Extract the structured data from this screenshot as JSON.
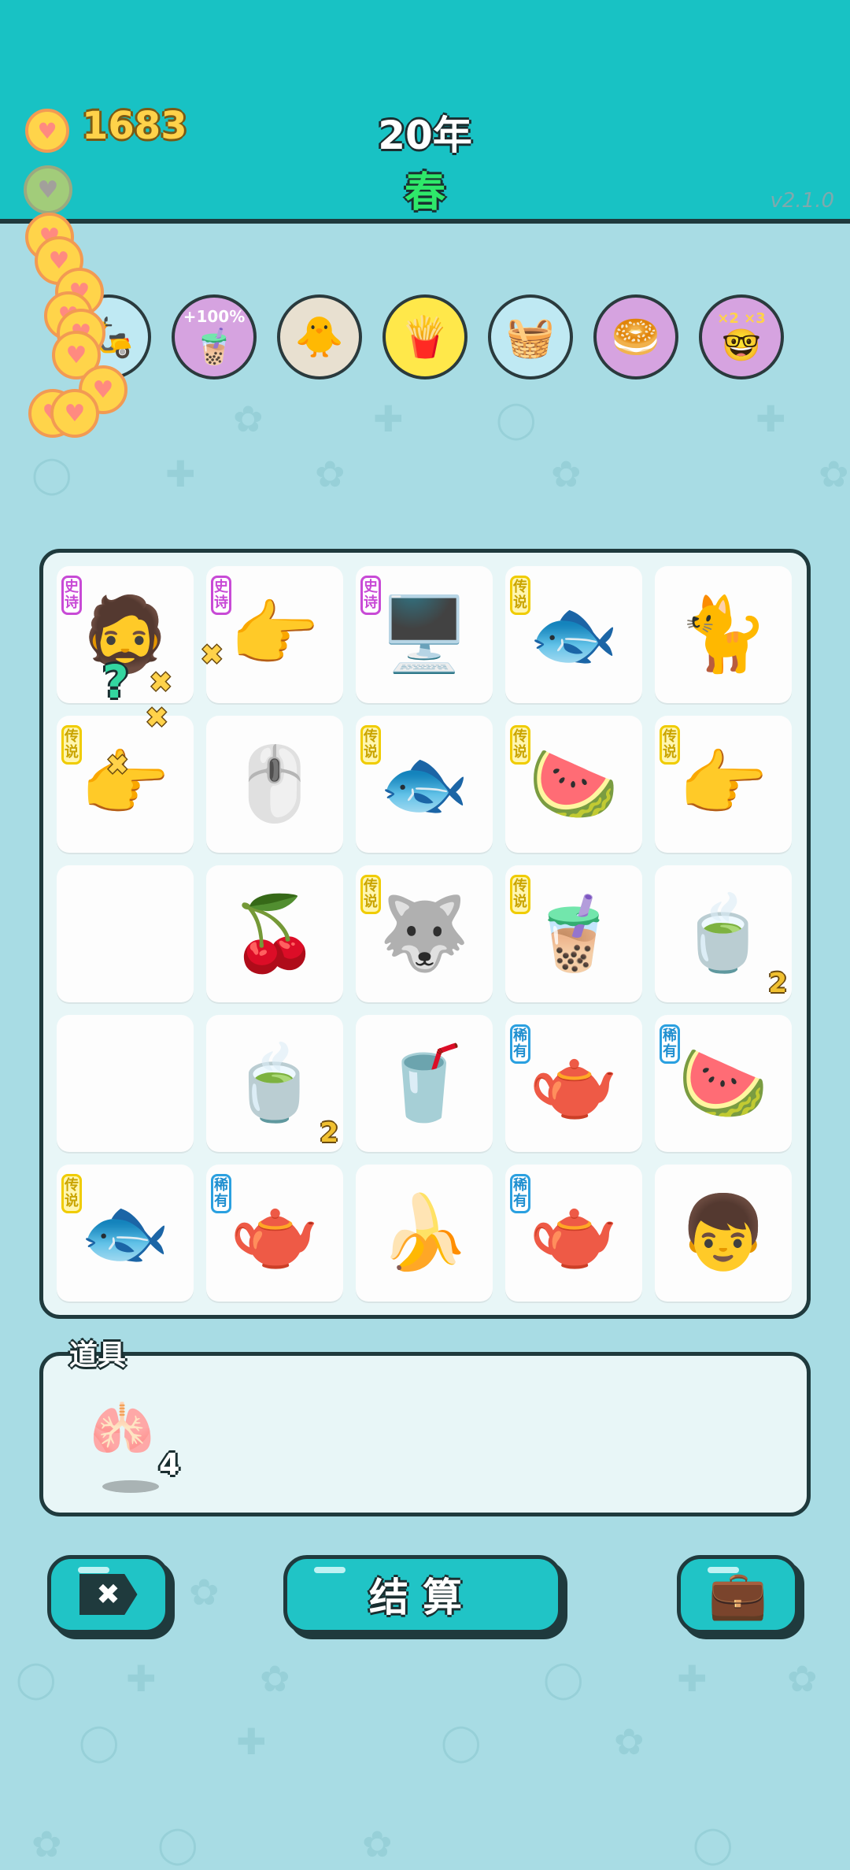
{
  "header": {
    "coins": "1683",
    "year": "20年",
    "season": "春",
    "version": "v2.1.0"
  },
  "relics": [
    {
      "name": "scooter",
      "icon": "🛵",
      "bg": "#bfe9f3"
    },
    {
      "name": "milk-tea-boost",
      "icon": "🧋",
      "label": "+100%",
      "bg": "#d6a3e0"
    },
    {
      "name": "chick-egg",
      "icon": "🐥",
      "bg": "#e8e0d0"
    },
    {
      "name": "fries",
      "icon": "🍟",
      "bg": "#ffe84a"
    },
    {
      "name": "fruit-basket",
      "icon": "🧺",
      "bg": "#bfe9f3"
    },
    {
      "name": "eyepatch",
      "icon": "🥯",
      "bg": "#d6a3e0"
    },
    {
      "name": "multiplier-nerd",
      "icon": "🤓",
      "label": "×2 ×3",
      "bg": "#d6a3e0"
    }
  ],
  "board": {
    "cells": [
      {
        "icon": "🧔",
        "tag": "史诗",
        "tagType": "epic",
        "count": ""
      },
      {
        "icon": "👉",
        "tag": "史诗",
        "tagType": "epic",
        "count": ""
      },
      {
        "icon": "🖥️",
        "tag": "史诗",
        "tagType": "epic",
        "count": ""
      },
      {
        "icon": "🐟",
        "tag": "传说",
        "tagType": "legend",
        "count": ""
      },
      {
        "icon": "🐈",
        "tag": "",
        "tagType": "",
        "count": ""
      },
      {
        "icon": "👉",
        "tag": "传说",
        "tagType": "legend",
        "count": ""
      },
      {
        "icon": "🖱️",
        "tag": "",
        "tagType": "",
        "count": ""
      },
      {
        "icon": "🐟",
        "tag": "传说",
        "tagType": "legend",
        "count": ""
      },
      {
        "icon": "🍉",
        "tag": "传说",
        "tagType": "legend",
        "count": ""
      },
      {
        "icon": "👉",
        "tag": "传说",
        "tagType": "legend",
        "count": ""
      },
      {
        "icon": "",
        "tag": "",
        "tagType": "",
        "count": ""
      },
      {
        "icon": "🍒",
        "tag": "",
        "tagType": "",
        "count": ""
      },
      {
        "icon": "🐺",
        "tag": "传说",
        "tagType": "legend",
        "count": ""
      },
      {
        "icon": "🧋",
        "tag": "传说",
        "tagType": "legend",
        "count": ""
      },
      {
        "icon": "🍵",
        "tag": "",
        "tagType": "",
        "count": "2"
      },
      {
        "icon": "",
        "tag": "",
        "tagType": "",
        "count": ""
      },
      {
        "icon": "🍵",
        "tag": "",
        "tagType": "",
        "count": "2"
      },
      {
        "icon": "🥤",
        "tag": "",
        "tagType": "",
        "count": ""
      },
      {
        "icon": "🫖",
        "tag": "稀有",
        "tagType": "rare",
        "count": ""
      },
      {
        "icon": "🍉",
        "tag": "稀有",
        "tagType": "rare",
        "count": ""
      },
      {
        "icon": "🐟",
        "tag": "传说",
        "tagType": "legend",
        "count": ""
      },
      {
        "icon": "🫖",
        "tag": "稀有",
        "tagType": "rare",
        "count": ""
      },
      {
        "icon": "🍌",
        "tag": "",
        "tagType": "",
        "count": ""
      },
      {
        "icon": "🫖",
        "tag": "稀有",
        "tagType": "rare",
        "count": ""
      },
      {
        "icon": "👦",
        "tag": "",
        "tagType": "",
        "count": ""
      }
    ]
  },
  "props": {
    "title": "道具",
    "item_icon": "🫁",
    "item_count": "4"
  },
  "buttons": {
    "exit_icon": "✖",
    "settle_label": "结算",
    "bag_icon": "💼"
  }
}
